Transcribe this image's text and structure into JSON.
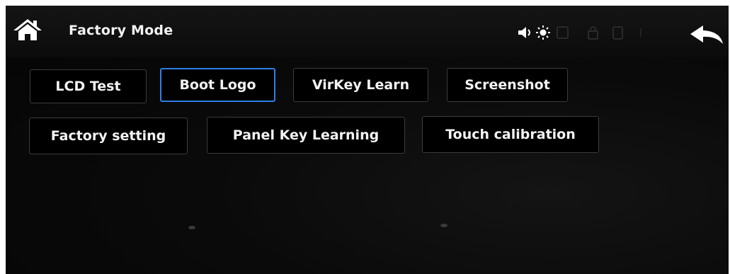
{
  "app": {
    "title": "Factory Mode"
  },
  "header": {
    "home_icon": "home-icon",
    "back_icon": "back-arrow-icon",
    "status_icons": [
      "speaker-icon",
      "brightness-icon",
      "square-icon",
      "lock-icon",
      "tablet-icon"
    ]
  },
  "buttons": {
    "lcd_test": "LCD Test",
    "boot_logo": "Boot Logo",
    "virkey_learn": "VirKey Learn",
    "screenshot": "Screenshot",
    "factory_setting": "Factory setting",
    "panel_key_learning": "Panel Key Learning",
    "touch_calibration": "Touch calibration"
  },
  "selected_button": "Boot Logo",
  "colors": {
    "background": "#0a0a0a",
    "text": "#f3f3f3",
    "button_border": "#3c3c3c",
    "selected_border": "#2f7fe6"
  }
}
